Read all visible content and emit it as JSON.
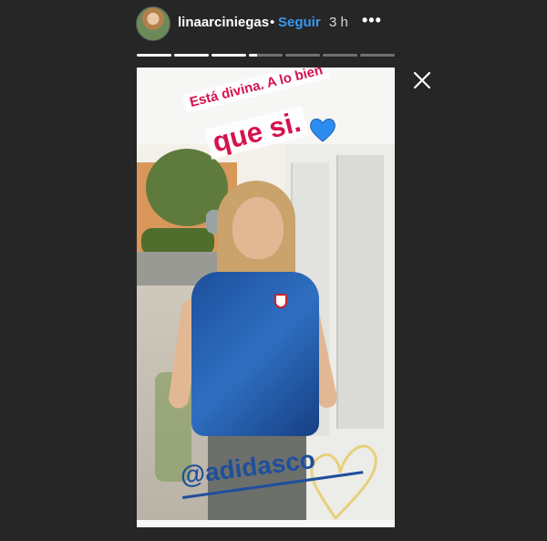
{
  "header": {
    "username": "linaarciniegas",
    "separator": "•",
    "follow_label": "Seguir",
    "time_ago": "3 h",
    "more_label": "•••"
  },
  "progress": {
    "segments": [
      1,
      1,
      1,
      0.25,
      0,
      0,
      0
    ]
  },
  "story": {
    "caption_line1": "Está divina. A lo bien",
    "caption_line2": "que si.",
    "mention": "@adidasco",
    "emoji": "blue-heart",
    "colors": {
      "caption": "#d4134f",
      "mention": "#1f4f9d",
      "heart": "#2d8cf0"
    }
  },
  "icons": {
    "close": "close-icon",
    "more": "more-options-icon"
  }
}
